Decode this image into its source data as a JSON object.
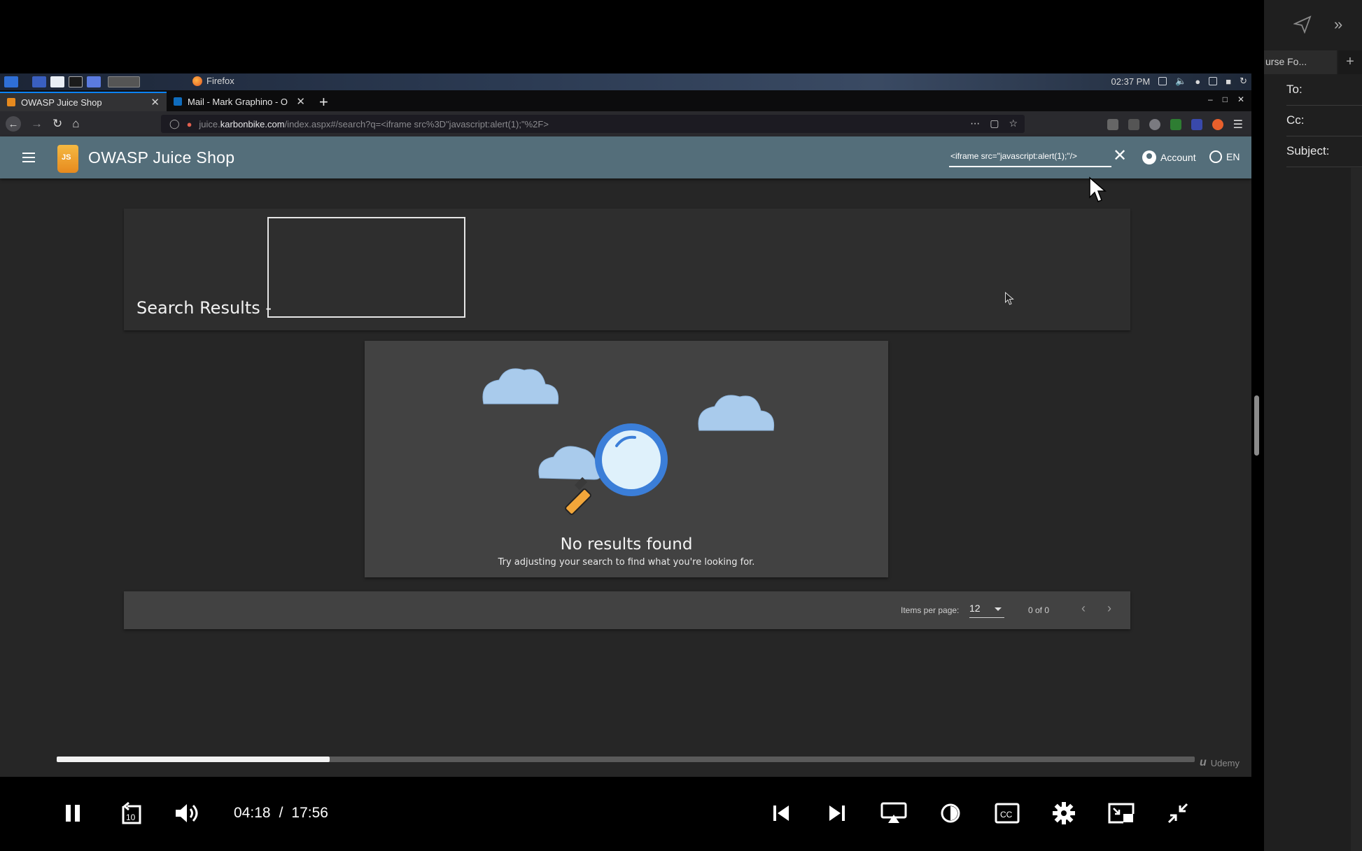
{
  "taskbar": {
    "app_label": "Firefox",
    "clock": "02:37 PM"
  },
  "browser": {
    "tabs": [
      {
        "title": "OWASP Juice Shop",
        "active": true
      },
      {
        "title": "Mail - Mark Graphino - O",
        "active": false
      }
    ],
    "url": {
      "prefix": "juice.",
      "domain": "karbonbike.com",
      "path": "/index.aspx#/search?q=<iframe src%3D\"javascript:alert(1);\"%2F>"
    }
  },
  "app": {
    "title": "OWASP Juice Shop",
    "logo_text": "JS",
    "search_value": "<iframe src=\"javascript:alert(1);\"/>",
    "account_label": "Account",
    "language_label": "EN",
    "brand_color": "#546e7a"
  },
  "results": {
    "label": "Search Results -"
  },
  "empty_state": {
    "title": "No results found",
    "subtitle": "Try adjusting your search to find what you're looking for."
  },
  "paginator": {
    "items_per_page_label": "Items per page:",
    "items_per_page_value": "12",
    "range_label": "0 of 0"
  },
  "player": {
    "current_time": "04:18",
    "separator": "/",
    "duration": "17:56",
    "progress_fraction": 0.2398,
    "watermark": "Udemy"
  },
  "mail_panel": {
    "tab_label": "urse Fo...",
    "to_label": "To:",
    "cc_label": "Cc:",
    "subject_label": "Subject:"
  }
}
